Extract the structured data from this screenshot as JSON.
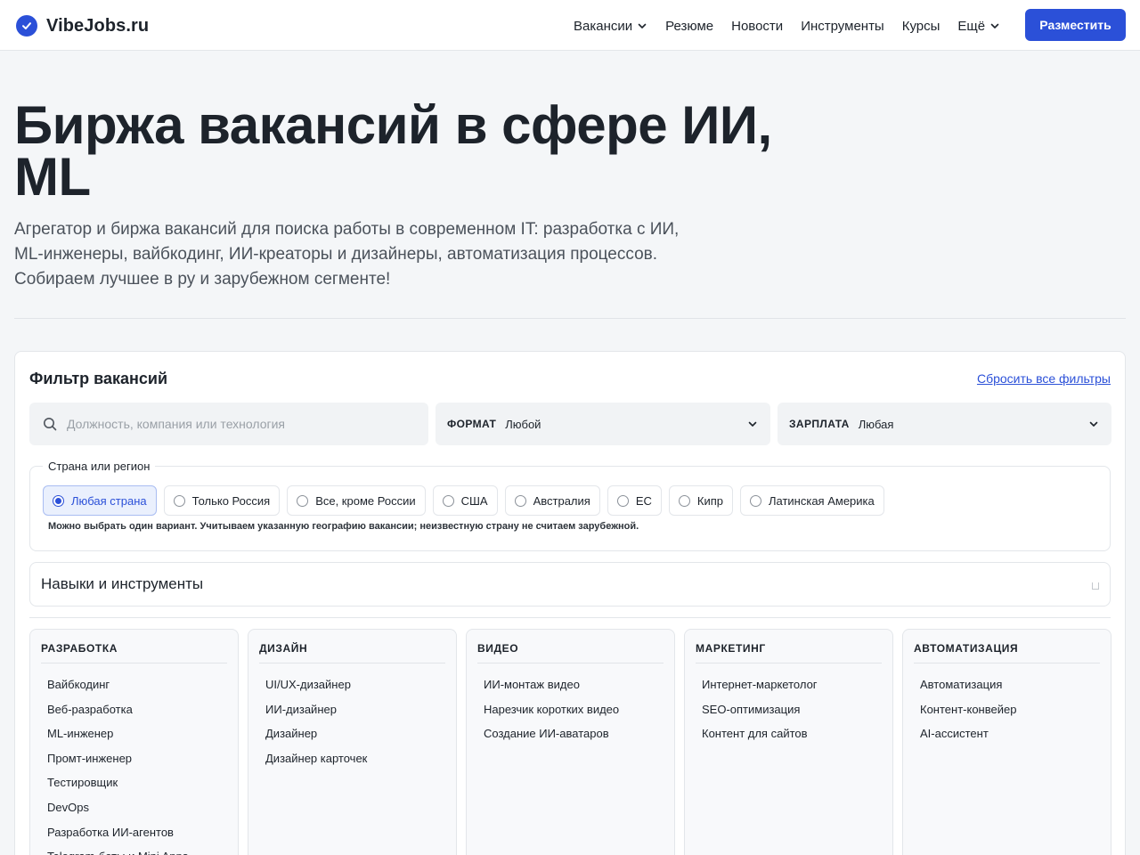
{
  "header": {
    "logo_text": "VibeJobs.ru",
    "nav": [
      {
        "label": "Вакансии",
        "dropdown": true
      },
      {
        "label": "Резюме",
        "dropdown": false
      },
      {
        "label": "Новости",
        "dropdown": false
      },
      {
        "label": "Инструменты",
        "dropdown": false
      },
      {
        "label": "Курсы",
        "dropdown": false
      },
      {
        "label": "Ещё",
        "dropdown": true
      }
    ],
    "post_button": "Разместить"
  },
  "hero": {
    "title": "Биржа вакансий в сфере ИИ, ML",
    "subtitle": "Агрегатор и биржа вакансий для поиска работы в современном IT: разработка с ИИ, ML-инженеры, вайбкодинг, ИИ-креаторы и дизайнеры, автоматизация процессов. Собираем лучшее в ру и зарубежном сегменте!"
  },
  "filter": {
    "title": "Фильтр вакансий",
    "reset_label": "Сбросить все фильтры",
    "search_placeholder": "Должность, компания или технология",
    "format": {
      "label": "ФОРМАТ",
      "value": "Любой"
    },
    "salary": {
      "label": "ЗАРПЛАТА",
      "value": "Любая"
    },
    "region": {
      "legend": "Страна или регион",
      "options": [
        {
          "label": "Любая страна",
          "selected": true
        },
        {
          "label": "Только Россия",
          "selected": false
        },
        {
          "label": "Все, кроме России",
          "selected": false
        },
        {
          "label": "США",
          "selected": false
        },
        {
          "label": "Австралия",
          "selected": false
        },
        {
          "label": "ЕС",
          "selected": false
        },
        {
          "label": "Кипр",
          "selected": false
        },
        {
          "label": "Латинская Америка",
          "selected": false
        }
      ],
      "note": "Можно выбрать один вариант. Учитываем указанную географию вакансии; неизвестную страну не считаем зарубежной."
    },
    "skills_title": "Навыки и инструменты",
    "categories": [
      {
        "title": "РАЗРАБОТКА",
        "items": [
          "Вайбкодинг",
          "Веб-разработка",
          "ML-инженер",
          "Промт-инженер",
          "Тестировщик",
          "DevOps",
          "Разработка ИИ-агентов",
          "Telegram-боты и Mini Apps"
        ]
      },
      {
        "title": "ДИЗАЙН",
        "items": [
          "UI/UX-дизайнер",
          "ИИ-дизайнер",
          "Дизайнер",
          "Дизайнер карточек"
        ]
      },
      {
        "title": "ВИДЕО",
        "items": [
          "ИИ-монтаж видео",
          "Нарезчик коротких видео",
          "Создание ИИ-аватаров"
        ]
      },
      {
        "title": "МАРКЕТИНГ",
        "items": [
          "Интернет-маркетолог",
          "SEO-оптимизация",
          "Контент для сайтов"
        ]
      },
      {
        "title": "АВТОМАТИЗАЦИЯ",
        "items": [
          "Автоматизация",
          "Контент-конвейер",
          "AI-ассистент"
        ]
      }
    ]
  },
  "colors": {
    "accent": "#2b50d8",
    "background": "#f4f6f8",
    "text": "#1d232b"
  }
}
